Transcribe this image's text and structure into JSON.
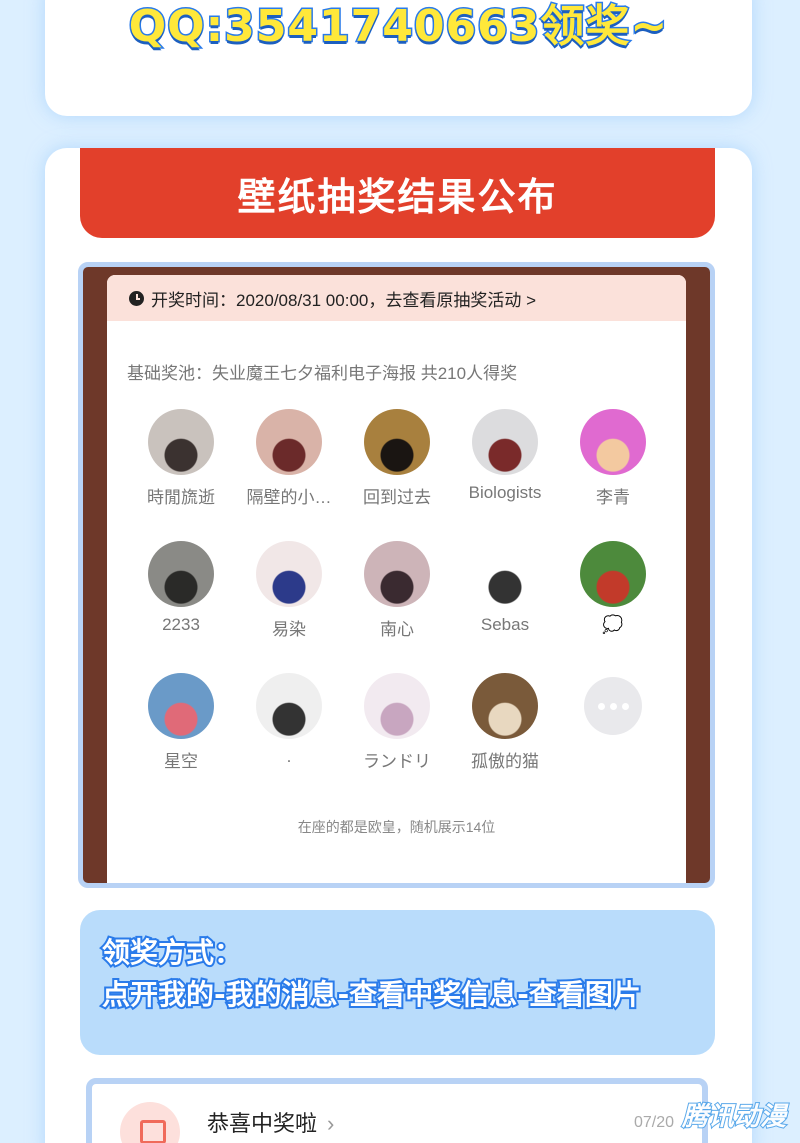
{
  "top": {
    "qq_text": "QQ:3541740663领奖~"
  },
  "banner": {
    "title": "壁纸抽奖结果公布"
  },
  "lottery": {
    "time_label": "开奖时间：2020/08/31 00:00，去查看原抽奖活动 >",
    "pool_label": "基础奖池：失业魔王七夕福利电子海报 共210人得奖",
    "winners": [
      {
        "name": "時閒旒逝",
        "color": "#c9c2bd",
        "accent": "#3b3230"
      },
      {
        "name": "隔壁的小…",
        "color": "#d9b3a8",
        "accent": "#6b2a2a"
      },
      {
        "name": "回到过去",
        "color": "#a8803e",
        "accent": "#1a1512"
      },
      {
        "name": "Biologists",
        "color": "#dcdcde",
        "accent": "#7a2a2a"
      },
      {
        "name": "李青",
        "color": "#e06ad0",
        "accent": "#f3c9a0"
      },
      {
        "name": "2233",
        "color": "#8a8a86",
        "accent": "#2a2a28"
      },
      {
        "name": "易染",
        "color": "#f1e7e7",
        "accent": "#2c3a8a"
      },
      {
        "name": "南心",
        "color": "#cdb4b8",
        "accent": "#3a2a30"
      },
      {
        "name": "Sebas",
        "color": "#ffffff",
        "accent": "#333333"
      },
      {
        "name": "💭",
        "color": "#4d8a3c",
        "accent": "#c23a2a"
      },
      {
        "name": "星空",
        "color": "#6a9ac8",
        "accent": "#e06a78"
      },
      {
        "name": ".",
        "color": "#efefef",
        "accent": "#333333"
      },
      {
        "name": "ランドリ",
        "color": "#f2eaf0",
        "accent": "#c8a6c0"
      },
      {
        "name": "孤傲的猫",
        "color": "#7a5a3a",
        "accent": "#e8d8c0"
      }
    ],
    "footnote": "在座的都是欧皇，随机展示14位"
  },
  "claim": {
    "line1": "领奖方式：",
    "line2": "点开我的-我的消息-查看中奖信息-查看图片"
  },
  "message": {
    "title": "恭喜中奖啦",
    "arrow": "›",
    "date": "07/20"
  },
  "watermark": "腾讯动漫"
}
